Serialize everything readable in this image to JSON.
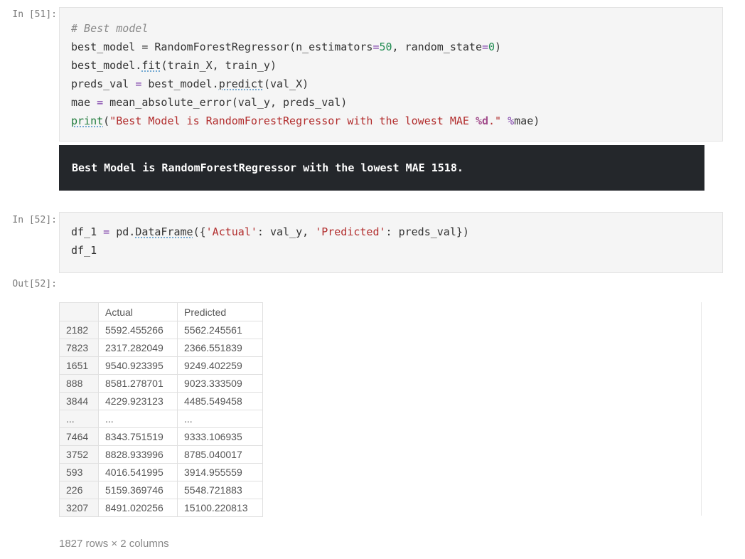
{
  "cells": {
    "cell51": {
      "prompt": "In [51]:",
      "code": {
        "line1_comment": "# Best model",
        "line2_a": "best_model = RandomForestRegressor(n_estimators",
        "line2_eq1": "=",
        "line2_n1": "50",
        "line2_b": ", random_state",
        "line2_eq2": "=",
        "line2_n2": "0",
        "line2_c": ")",
        "line3_a": "best_model.",
        "line3_fn": "fit",
        "line3_b": "(train_X, train_y)",
        "line4_a": "preds_val ",
        "line4_eq": "=",
        "line4_b": " best_model.",
        "line4_fn": "predict",
        "line4_c": "(val_X)",
        "line5_a": "mae ",
        "line5_eq": "=",
        "line5_b": " mean_absolute_error(val_y, preds_val)",
        "line6_print": "print",
        "line6_p1": "(",
        "line6_str1": "\"Best Model is RandomForestRegressor with the lowest MAE ",
        "line6_fmt": "%d",
        "line6_str2": ".\"",
        "line6_sp": " ",
        "line6_pct": "%",
        "line6_var": "mae",
        "line6_p2": ")"
      },
      "output": "Best Model is RandomForestRegressor with the lowest MAE 1518."
    },
    "cell52": {
      "prompt": "In [52]:",
      "code": {
        "line1_a": "df_1 ",
        "line1_eq": "=",
        "line1_b": " pd.",
        "line1_fn": "DataFrame",
        "line1_c": "({",
        "line1_s1": "'Actual'",
        "line1_d": ": val_y, ",
        "line1_s2": "'Predicted'",
        "line1_e": ": preds_val})",
        "line2": "df_1"
      },
      "out_prompt": "Out[52]:",
      "table": {
        "columns": [
          "",
          "Actual",
          "Predicted"
        ],
        "rows": [
          [
            "2182",
            "5592.455266",
            "5562.245561"
          ],
          [
            "7823",
            "2317.282049",
            "2366.551839"
          ],
          [
            "1651",
            "9540.923395",
            "9249.402259"
          ],
          [
            "888",
            "8581.278701",
            "9023.333509"
          ],
          [
            "3844",
            "4229.923123",
            "4485.549458"
          ],
          [
            "...",
            "...",
            "..."
          ],
          [
            "7464",
            "8343.751519",
            "9333.106935"
          ],
          [
            "3752",
            "8828.933996",
            "8785.040017"
          ],
          [
            "593",
            "4016.541995",
            "3914.955559"
          ],
          [
            "226",
            "5159.369746",
            "5548.721883"
          ],
          [
            "3207",
            "8491.020256",
            "15100.220813"
          ]
        ]
      },
      "shape": "1827 rows × 2 columns"
    }
  }
}
